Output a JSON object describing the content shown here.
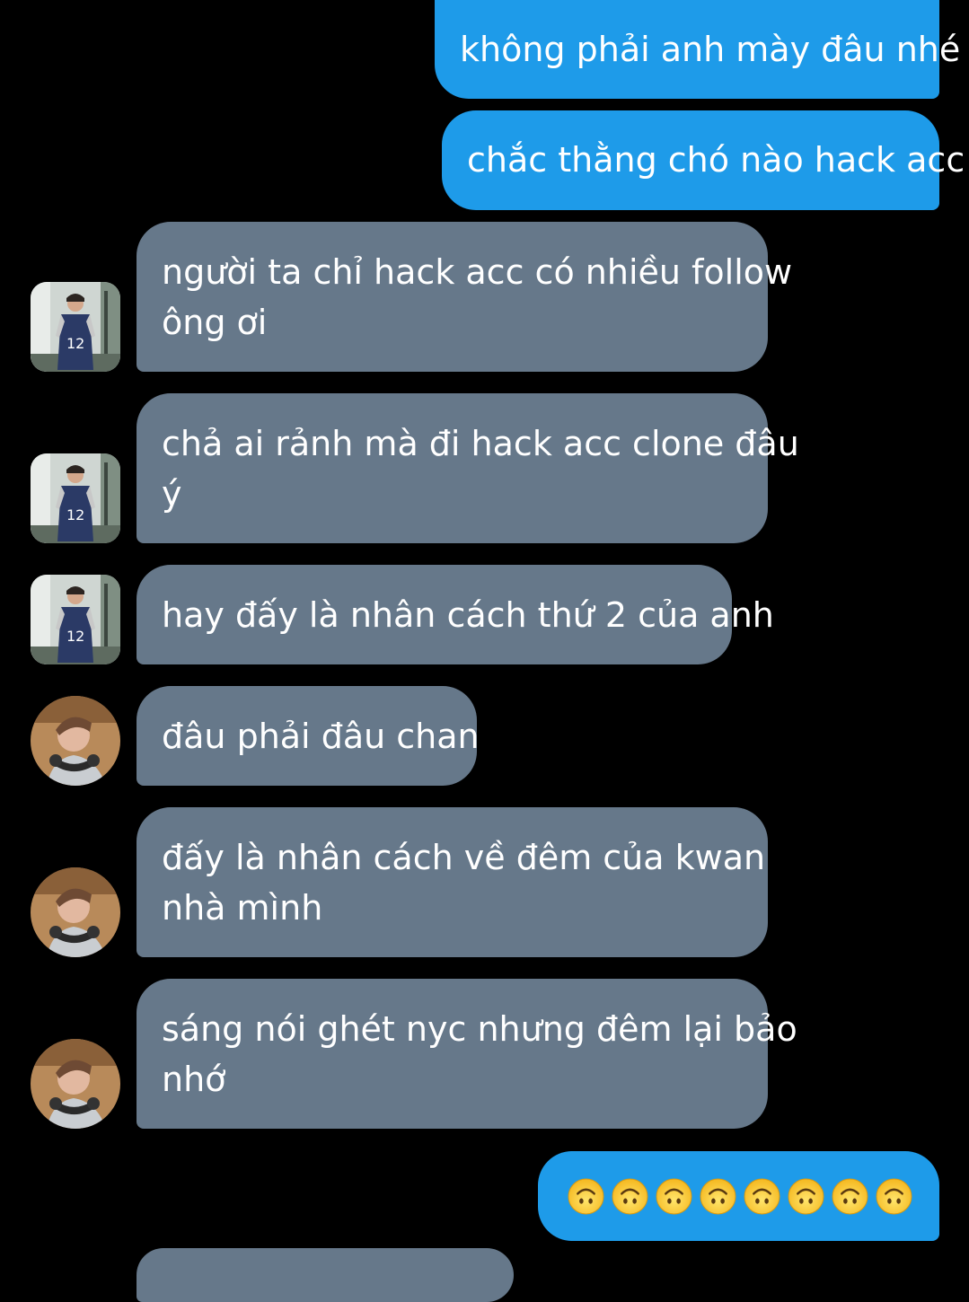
{
  "messages": [
    {
      "side": "sent",
      "lines": [
        "không phải anh mày đâu nhé"
      ]
    },
    {
      "side": "sent",
      "lines": [
        "chắc thằng chó nào hack acc"
      ]
    },
    {
      "side": "received",
      "avatar": "avatar-boy-jersey-icon",
      "lines": [
        "người ta chỉ hack acc có nhiều follow",
        "ông ơi"
      ]
    },
    {
      "side": "received",
      "avatar": "avatar-boy-jersey-icon",
      "lines": [
        "chả ai rảnh mà đi hack acc clone đâu",
        "ý"
      ]
    },
    {
      "side": "received",
      "avatar": "avatar-boy-jersey-icon",
      "lines": [
        "hay đấy là nhân cách thứ 2 của anh"
      ]
    },
    {
      "side": "received",
      "avatar": "avatar-boy-headphones-icon",
      "lines": [
        "đâu phải đâu chan"
      ]
    },
    {
      "side": "received",
      "avatar": "avatar-boy-headphones-icon",
      "lines": [
        "đấy là nhân cách về đêm của kwan",
        "nhà mình"
      ]
    },
    {
      "side": "received",
      "avatar": "avatar-boy-headphones-icon",
      "lines": [
        "sáng nói ghét nyc nhưng đêm lại bảo",
        "nhớ"
      ]
    },
    {
      "side": "sent",
      "emoji": "upside-down-face-icon",
      "emoji_count": 8
    }
  ],
  "colors": {
    "background": "#000000",
    "sent_bubble": "#1e9be9",
    "received_bubble": "#66788a",
    "text": "#ffffff"
  }
}
